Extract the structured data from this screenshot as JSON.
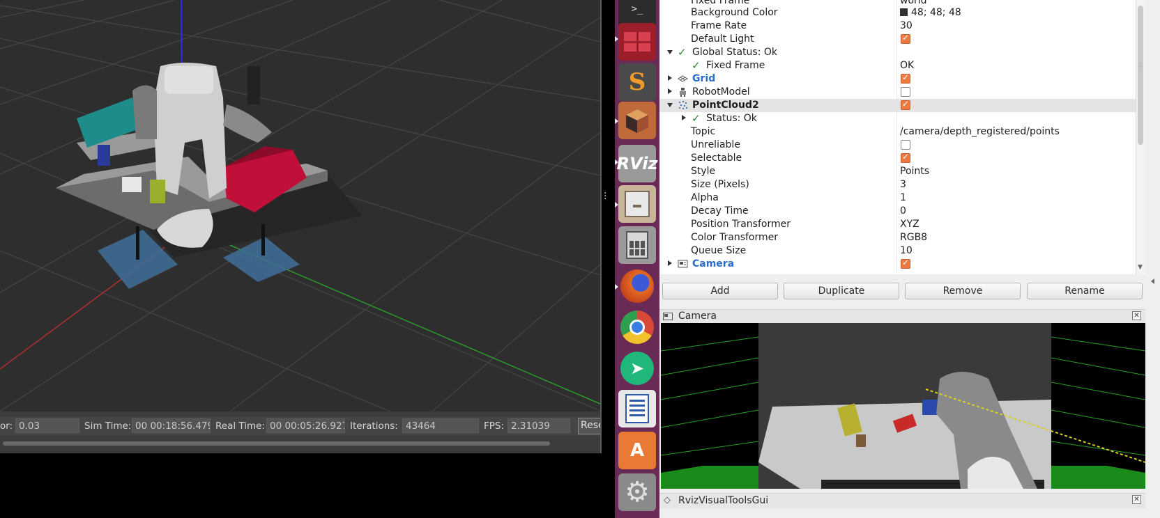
{
  "gazebo": {
    "status": {
      "factor_label": "or:",
      "factor_value": "0.03",
      "sim_time_label": "Sim Time:",
      "sim_time_value": "00 00:18:56.479",
      "real_time_label": "Real Time:",
      "real_time_value": "00 00:05:26.927",
      "iterations_label": "Iterations:",
      "iterations_value": "43464",
      "fps_label": "FPS:",
      "fps_value": "2.31039",
      "reset_label": "Reset"
    }
  },
  "launcher": {
    "apps": [
      {
        "name": "terminal-icon",
        "color": "#2c2c2c"
      },
      {
        "name": "workspaces-icon",
        "color": "#9c1e2a"
      },
      {
        "name": "sublime-text-icon",
        "color": "#4a4a4a"
      },
      {
        "name": "box-icon",
        "color": "#c0693a"
      },
      {
        "name": "rviz-icon",
        "color": "#9a9a9a"
      },
      {
        "name": "file-cabinet-icon",
        "color": "#c9b59a"
      },
      {
        "name": "calculator-icon",
        "color": "#9a9a9a"
      },
      {
        "name": "firefox-icon",
        "color": "#e26b22"
      },
      {
        "name": "chrome-icon",
        "color": "#dadada"
      },
      {
        "name": "send-icon",
        "color": "#1fb77a"
      },
      {
        "name": "writer-icon",
        "color": "#e8e8e8"
      },
      {
        "name": "software-center-icon",
        "color": "#e87a36"
      },
      {
        "name": "settings-icon",
        "color": "#8a8a8a"
      }
    ],
    "rviz_label": "RViz"
  },
  "rviz": {
    "properties": [
      {
        "name": "Fixed Frame",
        "value": "world"
      },
      {
        "name": "Background Color",
        "value": "48; 48; 48"
      },
      {
        "name": "Frame Rate",
        "value": "30"
      },
      {
        "name": "Default Light",
        "value": ""
      },
      {
        "name": "Global Status: Ok",
        "value": ""
      },
      {
        "name": "Fixed Frame",
        "value": "OK"
      },
      {
        "name": "Grid",
        "value": ""
      },
      {
        "name": "RobotModel",
        "value": ""
      },
      {
        "name": "PointCloud2",
        "value": ""
      },
      {
        "name": "Status: Ok",
        "value": ""
      },
      {
        "name": "Topic",
        "value": "/camera/depth_registered/points"
      },
      {
        "name": "Unreliable",
        "value": ""
      },
      {
        "name": "Selectable",
        "value": ""
      },
      {
        "name": "Style",
        "value": "Points"
      },
      {
        "name": "Size (Pixels)",
        "value": "3"
      },
      {
        "name": "Alpha",
        "value": "1"
      },
      {
        "name": "Decay Time",
        "value": "0"
      },
      {
        "name": "Position Transformer",
        "value": "XYZ"
      },
      {
        "name": "Color Transformer",
        "value": "RGB8"
      },
      {
        "name": "Queue Size",
        "value": "10"
      },
      {
        "name": "Camera",
        "value": ""
      }
    ],
    "checkboxes": {
      "default_light": true,
      "grid": true,
      "robot_model": false,
      "pointcloud2": true,
      "unreliable": false,
      "selectable": true,
      "camera": true
    },
    "buttons": {
      "add": "Add",
      "duplicate": "Duplicate",
      "remove": "Remove",
      "rename": "Rename"
    },
    "camera_panel_title": "Camera",
    "visual_tools_title": "RvizVisualToolsGui",
    "accent_color": "#ee7a43",
    "status_ok_color": "#2a8a2a"
  }
}
